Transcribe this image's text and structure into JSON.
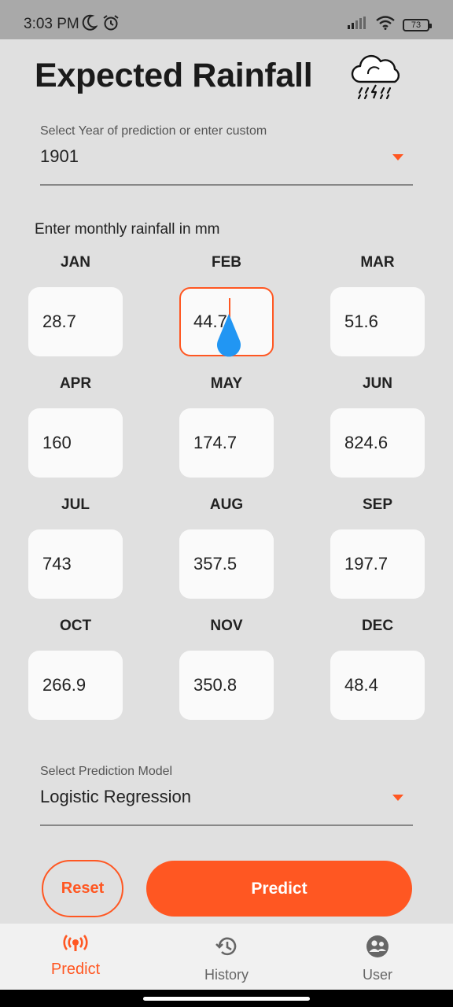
{
  "status_bar": {
    "time": "3:03 PM",
    "battery": "73"
  },
  "header": {
    "title": "Expected Rainfall",
    "icon": "rain-cloud-icon"
  },
  "year_select": {
    "label": "Select Year of prediction or enter custom",
    "value": "1901"
  },
  "monthly": {
    "section_label": "Enter monthly rainfall in mm",
    "months": [
      {
        "name": "JAN",
        "value": "28.7"
      },
      {
        "name": "FEB",
        "value": "44.7"
      },
      {
        "name": "MAR",
        "value": "51.6"
      },
      {
        "name": "APR",
        "value": "160"
      },
      {
        "name": "MAY",
        "value": "174.7"
      },
      {
        "name": "JUN",
        "value": "824.6"
      },
      {
        "name": "JUL",
        "value": "743"
      },
      {
        "name": "AUG",
        "value": "357.5"
      },
      {
        "name": "SEP",
        "value": "197.7"
      },
      {
        "name": "OCT",
        "value": "266.9"
      },
      {
        "name": "NOV",
        "value": "350.8"
      },
      {
        "name": "DEC",
        "value": "48.4"
      }
    ]
  },
  "model_select": {
    "label": "Select Prediction Model",
    "value": "Logistic Regression"
  },
  "actions": {
    "reset_label": "Reset",
    "predict_label": "Predict"
  },
  "bottom_nav": {
    "items": [
      {
        "label": "Predict",
        "icon": "broadcast-icon",
        "active": true
      },
      {
        "label": "History",
        "icon": "history-icon",
        "active": false
      },
      {
        "label": "User",
        "icon": "user-group-icon",
        "active": false
      }
    ]
  },
  "colors": {
    "accent": "#ff5722",
    "background": "#e0e0e0",
    "input_bg": "#fafafa"
  }
}
